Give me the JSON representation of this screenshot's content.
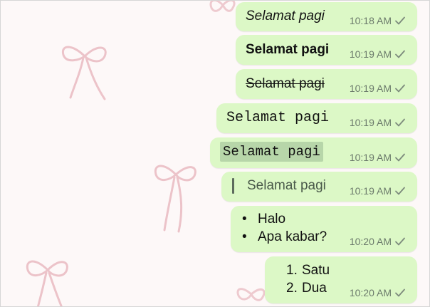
{
  "colors": {
    "outgoing_bubble": "#dcf8c6",
    "code_highlight": "#b7d6a9",
    "timestamp": "#6b7a6b",
    "wallpaper_ribbon": "#e8b7be"
  },
  "icons": {
    "sent_check": "single-check-icon",
    "wallpaper": "bow-ribbon-icon"
  },
  "main": {
    "date_label": "",
    "messages": [
      {
        "text": "Selamat pagi",
        "style": "italic",
        "time": "10:18 AM"
      },
      {
        "text": "Selamat pagi",
        "style": "bold",
        "time": "10:19 AM"
      },
      {
        "text": "Selamat pagi",
        "style": "strikethrough",
        "time": "10:19 AM"
      },
      {
        "text": "Selamat pagi",
        "style": "monospace",
        "time": "10:19 AM"
      },
      {
        "text": "Selamat pagi",
        "style": "inline-code",
        "time": "10:19 AM"
      },
      {
        "text": "Selamat pagi",
        "style": "quote",
        "time": "10:19 AM"
      },
      {
        "items": [
          "Halo",
          "Apa kabar?"
        ],
        "markers": [
          "•",
          "•"
        ],
        "style": "bulleted-list",
        "time": "10:20 AM"
      },
      {
        "items": [
          "Satu",
          "Dua"
        ],
        "markers": [
          "1.",
          "2."
        ],
        "style": "numbered-list",
        "time": "10:20 AM"
      }
    ]
  }
}
